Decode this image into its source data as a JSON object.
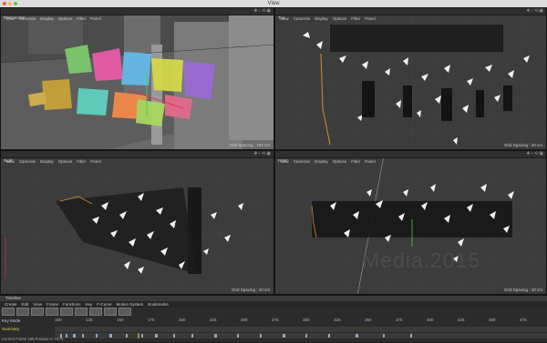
{
  "window": {
    "title": "View"
  },
  "viewport_menu": [
    "View",
    "Cameras",
    "Display",
    "Options",
    "Filter",
    "Panel"
  ],
  "viewports": [
    {
      "id": "perspective",
      "name": "Perspective",
      "grid": "Grid Spacing : 100 cm"
    },
    {
      "id": "top",
      "name": "Top",
      "grid": "Grid Spacing : 10 cm"
    },
    {
      "id": "right",
      "name": "Right",
      "grid": "Grid Spacing : 10 cm"
    },
    {
      "id": "front",
      "name": "Front",
      "grid": "Grid Spacing : 10 cm"
    }
  ],
  "watermark": "Media.2015",
  "timeline": {
    "title": "Timeline",
    "menu": [
      "Create",
      "Edit",
      "View",
      "Frame",
      "Functions",
      "Key",
      "F-Curve",
      "Motion System",
      "Bookmarks"
    ],
    "key_mode_label": "Key Mode",
    "summary_label": "Summary",
    "ruler": [
      "100",
      "125",
      "150",
      "175",
      "200",
      "225",
      "250",
      "275",
      "300",
      "325",
      "350",
      "375",
      "400",
      "425",
      "450",
      "475"
    ],
    "status": "Current Frame 168  Preview 0-->475"
  }
}
